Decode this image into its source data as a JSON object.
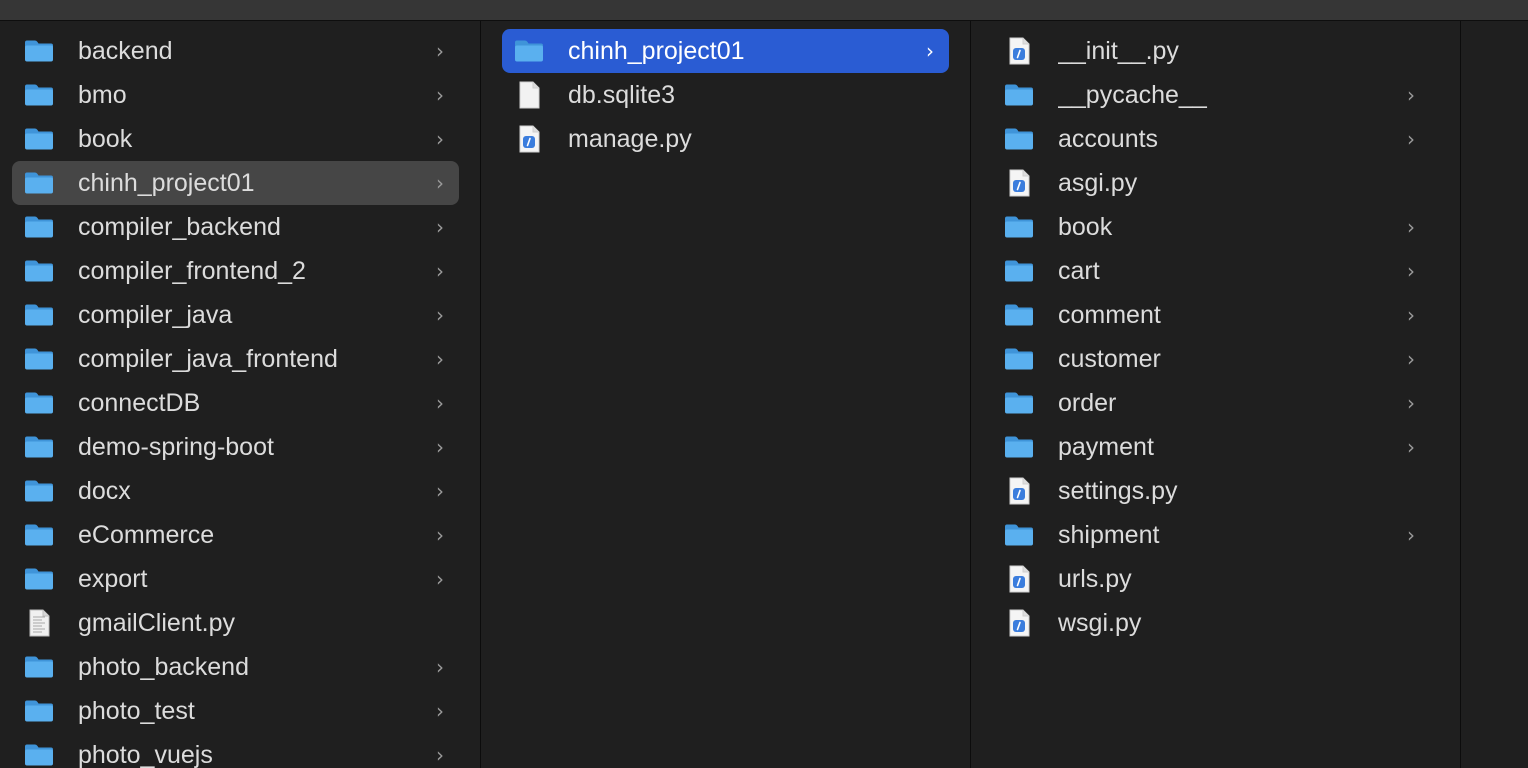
{
  "columns": [
    {
      "items": [
        {
          "name": "backend",
          "kind": "folder"
        },
        {
          "name": "bmo",
          "kind": "folder"
        },
        {
          "name": "book",
          "kind": "folder"
        },
        {
          "name": "chinh_project01",
          "kind": "folder",
          "selected": "inactive"
        },
        {
          "name": "compiler_backend",
          "kind": "folder"
        },
        {
          "name": "compiler_frontend_2",
          "kind": "folder"
        },
        {
          "name": "compiler_java",
          "kind": "folder"
        },
        {
          "name": "compiler_java_frontend",
          "kind": "folder"
        },
        {
          "name": "connectDB",
          "kind": "folder"
        },
        {
          "name": "demo-spring-boot",
          "kind": "folder"
        },
        {
          "name": "docx",
          "kind": "folder"
        },
        {
          "name": "eCommerce",
          "kind": "folder"
        },
        {
          "name": "export",
          "kind": "folder"
        },
        {
          "name": "gmailClient.py",
          "kind": "doc-file"
        },
        {
          "name": "photo_backend",
          "kind": "folder"
        },
        {
          "name": "photo_test",
          "kind": "folder"
        },
        {
          "name": "photo_vuejs",
          "kind": "folder"
        }
      ]
    },
    {
      "items": [
        {
          "name": "chinh_project01",
          "kind": "folder",
          "selected": "active"
        },
        {
          "name": "db.sqlite3",
          "kind": "blank-file"
        },
        {
          "name": "manage.py",
          "kind": "python-file"
        }
      ]
    },
    {
      "items": [
        {
          "name": "__init__.py",
          "kind": "python-file"
        },
        {
          "name": "__pycache__",
          "kind": "folder"
        },
        {
          "name": "accounts",
          "kind": "folder"
        },
        {
          "name": "asgi.py",
          "kind": "python-file"
        },
        {
          "name": "book",
          "kind": "folder"
        },
        {
          "name": "cart",
          "kind": "folder"
        },
        {
          "name": "comment",
          "kind": "folder"
        },
        {
          "name": "customer",
          "kind": "folder"
        },
        {
          "name": "order",
          "kind": "folder"
        },
        {
          "name": "payment",
          "kind": "folder"
        },
        {
          "name": "settings.py",
          "kind": "python-file"
        },
        {
          "name": "shipment",
          "kind": "folder"
        },
        {
          "name": "urls.py",
          "kind": "python-file"
        },
        {
          "name": "wsgi.py",
          "kind": "python-file"
        }
      ]
    }
  ],
  "chevron_glyph": "›",
  "colors": {
    "background": "#1f1f1f",
    "selection_active": "#2a5cd3",
    "selection_inactive": "#464646",
    "folder_blue": "#5ab0ef",
    "text": "#dcdcdc"
  },
  "icon_names": {
    "folder": "folder-icon",
    "python-file": "python-file-icon",
    "blank-file": "blank-file-icon",
    "doc-file": "document-file-icon"
  }
}
